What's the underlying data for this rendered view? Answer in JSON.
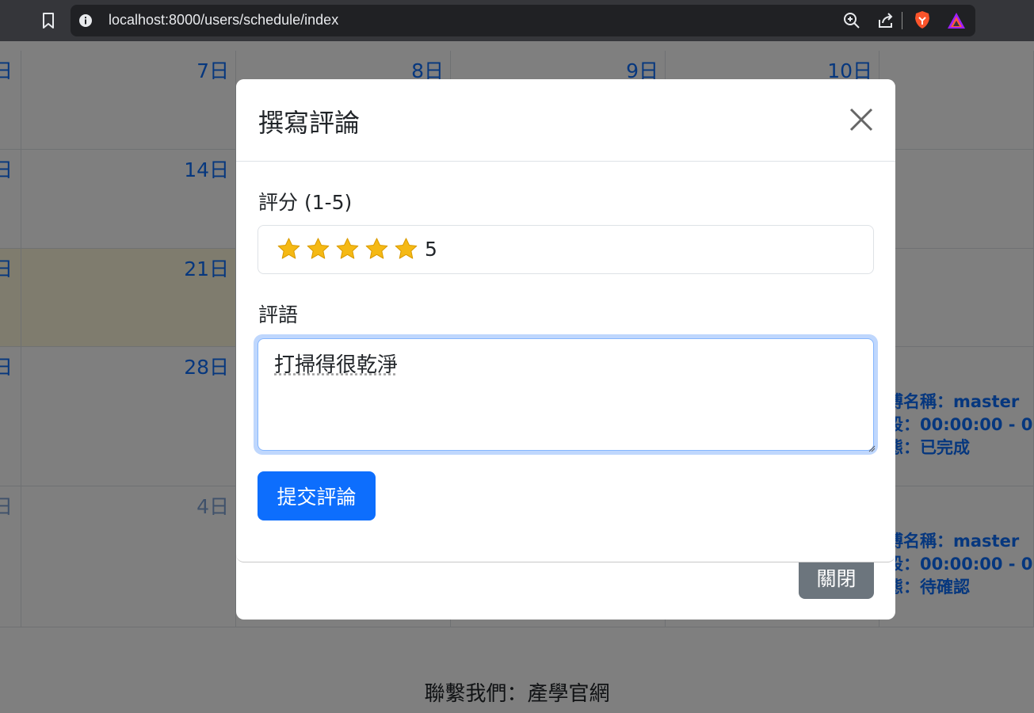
{
  "browser": {
    "url": "localhost:8000/users/schedule/index"
  },
  "calendar": {
    "rows": [
      {
        "days": [
          "日",
          "7日",
          "8日",
          "9日",
          "10日",
          ""
        ]
      },
      {
        "days": [
          "日",
          "14日",
          "",
          "",
          "",
          ""
        ]
      },
      {
        "days": [
          "日",
          "21日",
          "",
          "",
          "",
          ""
        ]
      },
      {
        "days": [
          "日",
          "28日",
          "",
          "",
          "",
          ""
        ]
      },
      {
        "days": [
          "日",
          "4日",
          "",
          "",
          "",
          ""
        ]
      }
    ],
    "events": [
      {
        "master": "師傅名稱：master",
        "time": "時段：00:00:00 - 0",
        "status": "狀態：已完成"
      },
      {
        "master": "師傅名稱：master",
        "time": "時段：00:00:00 - 0",
        "status": "狀態：待確認"
      }
    ],
    "footer": "聯繫我們：產學官網"
  },
  "modal": {
    "title": "撰寫評論",
    "rating_label": "評分 (1-5)",
    "rating": 5,
    "rating_text": "5",
    "comment_label": "評語",
    "comment_value": "打掃得很乾淨",
    "submit_label": "提交評論",
    "close_label": "關閉"
  },
  "colors": {
    "primary": "#0d6efd",
    "secondary": "#6c757d",
    "star": "#f5b914"
  }
}
